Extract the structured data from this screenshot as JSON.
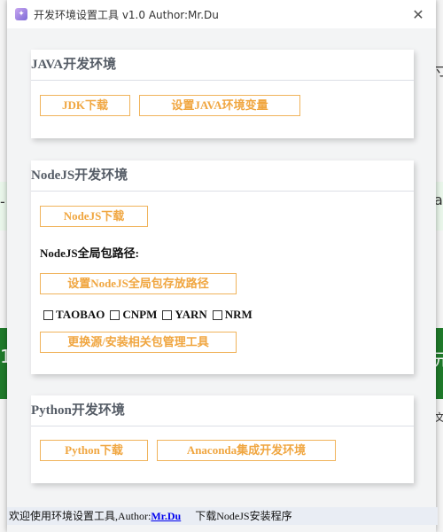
{
  "window": {
    "title": "开发环境设置工具 v1.0 Author:Mr.Du",
    "close_glyph": "✕"
  },
  "background": {
    "frag_top_right": "寸",
    "frag_mid_left": "-",
    "frag_mid_right": "a",
    "frag_green_left": "1",
    "frag_green_right": "元",
    "frag_bottom_right": "文"
  },
  "java": {
    "title": "JAVA开发环境",
    "jdk_download": "JDK下载",
    "set_java_env": "设置JAVA环境变量"
  },
  "node": {
    "title": "NodeJS开发环境",
    "download": "NodeJS下载",
    "global_path_label": "NodeJS全局包路径:",
    "set_global_path": "设置NodeJS全局包存放路径",
    "registries": [
      "TAOBAO",
      "CNPM",
      "YARN",
      "NRM"
    ],
    "switch_registry": "更换源/安装相关包管理工具"
  },
  "python": {
    "title": "Python开发环境",
    "download": "Python下载",
    "anaconda": "Anaconda集成开发环境"
  },
  "status": {
    "welcome": "欢迎使用环境设置工具,Author:",
    "author_link": "Mr.Du",
    "node_install": "下载NodeJS安装程序"
  }
}
